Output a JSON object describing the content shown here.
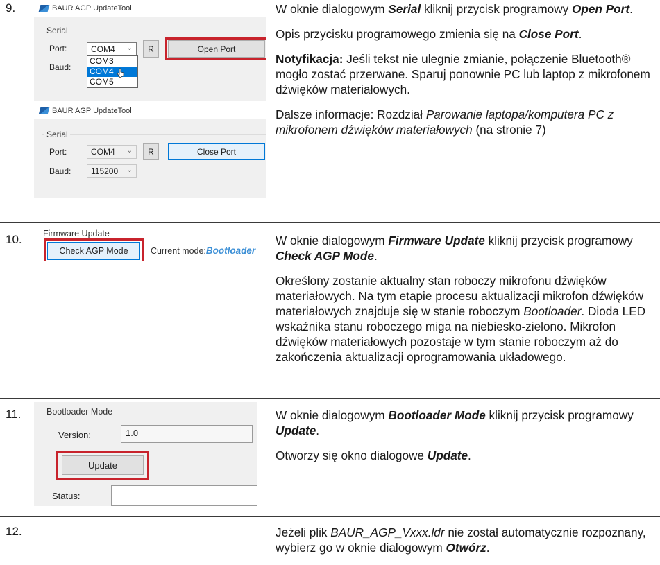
{
  "steps": [
    {
      "number": "9.",
      "screens": [
        {
          "app_title": "BAUR AGP UpdateTool",
          "group": "Serial",
          "port_label": "Port:",
          "port_value": "COM4",
          "baud_label": "Baud:",
          "refresh_label": "R",
          "button": "Open Port",
          "dropdown": [
            "COM3",
            "COM4",
            "COM5"
          ]
        },
        {
          "app_title": "BAUR AGP UpdateTool",
          "group": "Serial",
          "port_label": "Port:",
          "port_value": "COM4",
          "baud_label": "Baud:",
          "baud_value": "115200",
          "refresh_label": "R",
          "button": "Close Port"
        }
      ],
      "text": {
        "p1_a": "W oknie dialogowym ",
        "p1_b": "Serial",
        "p1_c": " kliknij przycisk programowy ",
        "p1_d": "Open Port",
        "p1_e": ".",
        "p2_a": "Opis przycisku programowego zmienia się na ",
        "p2_b": "Close Port",
        "p2_c": ".",
        "p3_a": "Notyfikacja:",
        "p3_b": " Jeśli tekst nie ulegnie zmianie, połączenie Bluetooth® mogło zostać przerwane. Sparuj ponownie PC lub laptop z mikrofonem dźwięków materiałowych.",
        "p4_a": "Dalsze informacje: Rozdział ",
        "p4_b": "Parowanie laptopa/komputera PC z mikrofonem dźwięków materiałowych",
        "p4_c": " (na stronie 7)"
      }
    },
    {
      "number": "10.",
      "screen": {
        "group": "Firmware Update",
        "button": "Check AGP Mode",
        "mode_label": "Current mode:",
        "mode_value": "Bootloader"
      },
      "text": {
        "p1_a": "W oknie dialogowym ",
        "p1_b": "Firmware Update",
        "p1_c": " kliknij przycisk programowy ",
        "p1_d": "Check AGP Mode",
        "p1_e": ".",
        "p2_a": "Określony zostanie aktualny stan roboczy mikrofonu dźwięków materiałowych. Na tym etapie procesu aktualizacji mikrofon dźwięków materiałowych znajduje się w stanie roboczym ",
        "p2_b": "Bootloader",
        "p2_c": ". Dioda LED wskaźnika stanu roboczego miga na niebiesko-zielono. Mikrofon dźwięków materiałowych pozostaje w tym stanie roboczym aż do zakończenia aktualizacji oprogramowania układowego."
      }
    },
    {
      "number": "11.",
      "screen": {
        "group": "Bootloader Mode",
        "version_label": "Version:",
        "version_value": "1.0",
        "button": "Update",
        "status_label": "Status:"
      },
      "text": {
        "p1_a": "W oknie dialogowym ",
        "p1_b": "Bootloader Mode",
        "p1_c": " kliknij przycisk programowy ",
        "p1_d": "Update",
        "p1_e": ".",
        "p2_a": "Otworzy się okno dialogowe ",
        "p2_b": "Update",
        "p2_c": "."
      }
    },
    {
      "number": "12.",
      "text": {
        "p1_a": "Jeżeli plik ",
        "p1_b": "BAUR_AGP_Vxxx.ldr",
        "p1_c": " nie został automatycznie rozpoznany, wybierz go w oknie dialogowym ",
        "p1_d": "Otwórz",
        "p1_e": "."
      }
    }
  ],
  "colors": {
    "highlight_red": "#c8232c",
    "selection_blue": "#0078d7",
    "mode_blue": "#3b8fd6",
    "rule": "#3a3a3a"
  }
}
